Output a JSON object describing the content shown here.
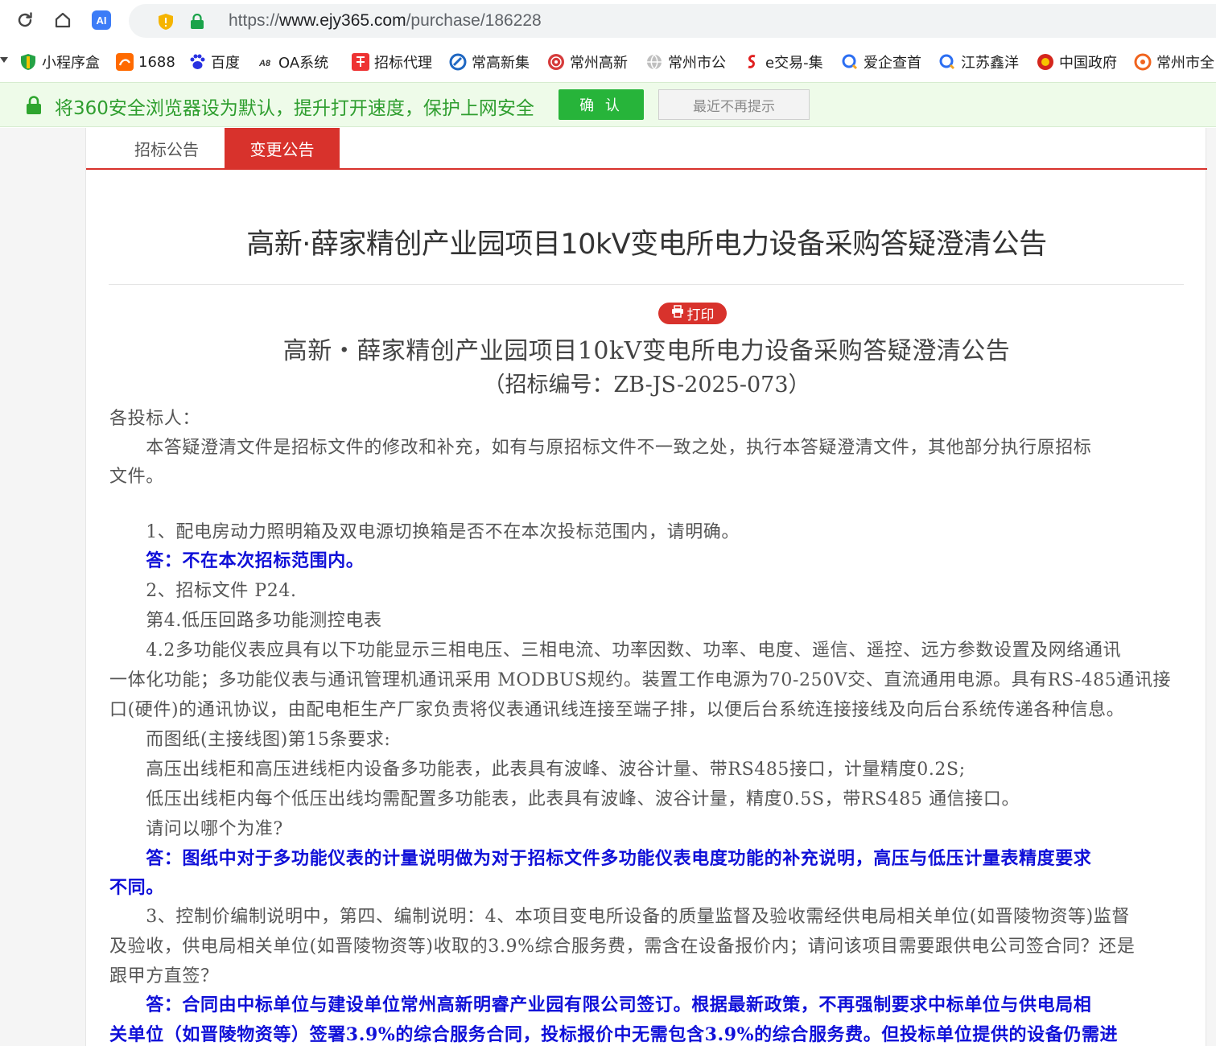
{
  "browser": {
    "url_prefix": "https://",
    "url_host": "www.ejy365.com",
    "url_path": "/purchase/186228",
    "bookmarks": [
      {
        "label": "小程序盒",
        "icon": "shield-leaf-icon"
      },
      {
        "label": "1688",
        "icon": "1688-logo-icon"
      },
      {
        "label": "百度",
        "icon": "baidu-paw-icon"
      },
      {
        "label": "OA系统",
        "icon": "oa-logo-icon"
      },
      {
        "label": "招标代理",
        "icon": "tender-logo-icon"
      },
      {
        "label": "常高新集",
        "icon": "company-logo-icon"
      },
      {
        "label": "常州高新",
        "icon": "seal-icon"
      },
      {
        "label": "常州市公",
        "icon": "globe-icon"
      },
      {
        "label": "e交易-集",
        "icon": "e-trade-logo-icon"
      },
      {
        "label": "爱企查首",
        "icon": "search-logo-icon"
      },
      {
        "label": "江苏鑫洋",
        "icon": "search-logo-icon"
      },
      {
        "label": "中国政府",
        "icon": "emblem-icon"
      },
      {
        "label": "常州市全",
        "icon": "circle-logo-icon"
      }
    ],
    "infobar": {
      "text": "将360安全浏览器设为默认，提升打开速度，保护上网安全",
      "confirm": "确 认",
      "dismiss": "最近不再提示"
    }
  },
  "tabs": [
    {
      "label": "招标公告",
      "active": false
    },
    {
      "label": "变更公告",
      "active": true
    }
  ],
  "page_title": "高新·薛家精创产业园项目10kV变电所电力设备采购答疑澄清公告",
  "print_label": "打印",
  "doc": {
    "title": "高新・薛家精创产业园项目10kV变电所电力设备采购答疑澄清公告",
    "number": "（招标编号：ZB-JS-2025-073）",
    "lines": [
      {
        "text": "各投标人：",
        "style": "gray"
      },
      {
        "text": "　　本答疑澄清文件是招标文件的修改和补充，如有与原招标文件不一致之处，执行本答疑澄清文件，其他部分执行原招标",
        "style": "gray"
      },
      {
        "text": "文件。",
        "style": "gray"
      },
      {
        "text": "　　1、配电房动力照明箱及双电源切换箱是否不在本次投标范围内，请明确。",
        "style": "gray"
      },
      {
        "text": "　　答：不在本次招标范围内。",
        "style": "blue"
      },
      {
        "text": "　　2、招标文件 P24.",
        "style": "gray"
      },
      {
        "text": "　　第4.低压回路多功能测控电表",
        "style": "gray"
      },
      {
        "text": "　　4.2多功能仪表应具有以下功能显示三相电压、三相电流、功率因数、功率、电度、遥信、遥控、远方参数设置及网络通讯",
        "style": "gray"
      },
      {
        "text": "一体化功能；多功能仪表与通讯管理机通讯采用 MODBUS规约。装置工作电源为70-250V交、直流通用电源。具有RS-485通讯接",
        "style": "gray"
      },
      {
        "text": "口(硬件)的通讯协议，由配电柜生产厂家负责将仪表通讯线连接至端子排，以便后台系统连接接线及向后台系统传递各种信息。",
        "style": "gray"
      },
      {
        "text": "　　而图纸(主接线图)第15条要求:",
        "style": "gray"
      },
      {
        "text": "　　高压出线柜和高压进线柜内设备多功能表，此表具有波峰、波谷计量、带RS485接口，计量精度0.2S;",
        "style": "gray"
      },
      {
        "text": "　　低压出线柜内每个低压出线均需配置多功能表，此表具有波峰、波谷计量，精度0.5S，带RS485 通信接口。",
        "style": "gray"
      },
      {
        "text": "　　请问以哪个为准?",
        "style": "gray"
      },
      {
        "text": "　　答：图纸中对于多功能仪表的计量说明做为对于招标文件多功能仪表电度功能的补充说明，高压与低压计量表精度要求",
        "style": "blue"
      },
      {
        "text": "不同。",
        "style": "blue"
      },
      {
        "text": "　　3、控制价编制说明中，第四、编制说明：4、本项目变电所设备的质量监督及验收需经供电局相关单位(如晋陵物资等)监督",
        "style": "gray"
      },
      {
        "text": "及验收，供电局相关单位(如晋陵物资等)收取的3.9%综合服务费，需含在设备报价内；请问该项目需要跟供电公司签合同？还是",
        "style": "gray"
      },
      {
        "text": "跟甲方直签？",
        "style": "gray"
      },
      {
        "text": "　　答：合同由中标单位与建设单位常州高新明睿产业园有限公司签订。根据最新政策，不再强制要求中标单位与供电局相",
        "style": "blue"
      },
      {
        "text": "关单位（如晋陵物资等）签署3.9%的综合服务合同，投标报价中无需包含3.9%的综合服务费。但投标单位提供的设备仍需进",
        "style": "blue"
      }
    ]
  }
}
